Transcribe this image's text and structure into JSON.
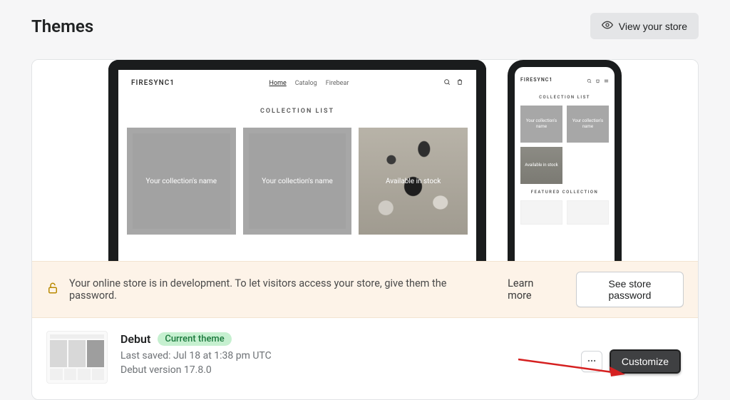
{
  "header": {
    "title": "Themes",
    "view_store_label": "View your store"
  },
  "preview": {
    "brand": "FIRESYNC1",
    "nav": {
      "home": "Home",
      "catalog": "Catalog",
      "firebear": "Firebear"
    },
    "section_collection_title": "COLLECTION LIST",
    "section_featured_title": "FEATURED COLLECTION",
    "tile_label_collection": "Your collection's name",
    "tile_label_stock": "Available in stock"
  },
  "banner": {
    "message": "Your online store is in development. To let visitors access your store, give them the password.",
    "learn_more": "Learn more",
    "see_password": "See store password"
  },
  "theme": {
    "name": "Debut",
    "badge": "Current theme",
    "last_saved": "Last saved: Jul 18 at 1:38 pm UTC",
    "version": "Debut version 17.8.0",
    "customize": "Customize"
  }
}
